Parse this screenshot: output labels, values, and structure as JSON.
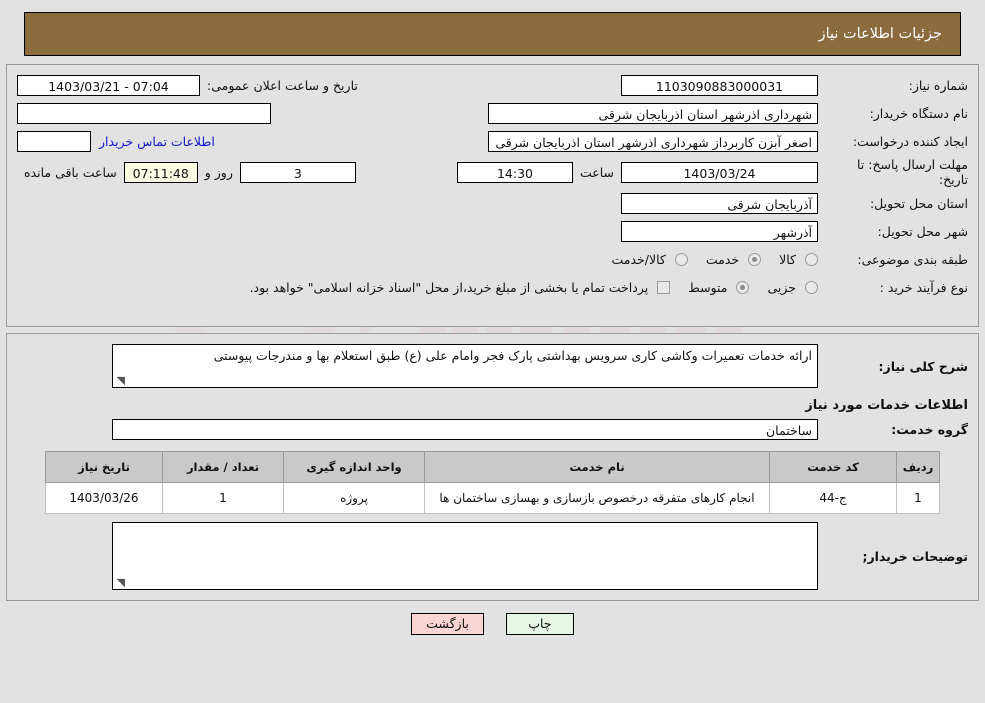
{
  "header": {
    "title": "جزئیات اطلاعات نیاز",
    "background": "#8c6b3f",
    "text_color": "#ffffff"
  },
  "form": {
    "need_number_label": "شماره نیاز:",
    "need_number_value": "1103090883000031",
    "announce_label": "تاریخ و ساعت اعلان عمومی:",
    "announce_value": "07:04 - 1403/03/21",
    "buyer_org_label": "نام دستگاه خریدار:",
    "buyer_org_value": "شهرداری اذرشهر استان اذربایجان شرقی",
    "creator_label": "ایجاد کننده درخواست:",
    "creator_value": "اصغر آبزن کاربرداز شهرداری اذرشهر استان اذربایجان شرقی",
    "contact_link": "اطلاعات تماس خریدار",
    "deadline_label": "مهلت ارسال پاسخ: تا تاریخ:",
    "deadline_date": "1403/03/24",
    "hour_label": "ساعت",
    "hour_value": "14:30",
    "days_value": "3",
    "days_label": "روز و",
    "countdown_value": "07:11:48",
    "countdown_label": "ساعت باقی مانده",
    "province_label": "استان محل تحویل:",
    "province_value": "آذربایجان شرقی",
    "city_label": "شهر محل تحویل:",
    "city_value": "آذرشهر",
    "category_label": "طبقه بندی موضوعی:",
    "category_options": [
      {
        "label": "کالا",
        "selected": false
      },
      {
        "label": "خدمت",
        "selected": true
      },
      {
        "label": "کالا/خدمت",
        "selected": false
      }
    ],
    "purchase_label": "نوع فرآیند خرید :",
    "purchase_options": [
      {
        "label": "جزیی",
        "selected": false
      },
      {
        "label": "متوسط",
        "selected": true
      }
    ],
    "treasury_checkbox_checked": false,
    "treasury_text": "پرداخت تمام یا بخشی از مبلغ خرید،از محل \"اسناد خزانه اسلامی\" خواهد بود."
  },
  "description": {
    "label": "شرح کلی نیاز:",
    "value": "ارائه خدمات تعمیرات وکاشی کاری سرویس بهداشتی پارک فجر وامام علی (ع) طبق استعلام بها و مندرجات پیوستی"
  },
  "services": {
    "section_title": "اطلاعات خدمات مورد نیاز",
    "group_label": "گروه خدمت:",
    "group_value": "ساختمان",
    "columns": [
      "ردیف",
      "کد خدمت",
      "نام خدمت",
      "واحد اندازه گیری",
      "تعداد / مقدار",
      "تاریخ نیاز"
    ],
    "rows": [
      {
        "row": "1",
        "code": "ج-44",
        "name": "انجام کارهای متفرقه درخصوص بازسازی و بهسازی ساختمان ها",
        "unit": "پروژه",
        "qty": "1",
        "date": "1403/03/26"
      }
    ]
  },
  "comments": {
    "label": "توضیحات خریدار;",
    "value": ""
  },
  "footer": {
    "print_label": "چاپ",
    "back_label": "بازگشت"
  }
}
